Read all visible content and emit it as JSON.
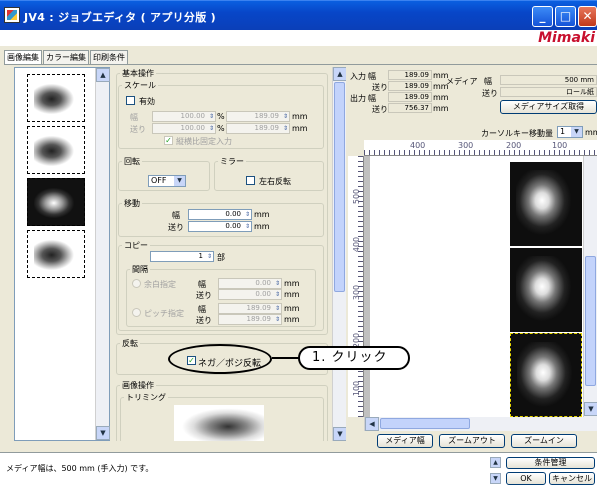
{
  "window": {
    "title": "JV4 : ジョブエディタ ( アプリ分版 )",
    "brand": "Mimaki",
    "min": "_",
    "max": "□",
    "close": "✕"
  },
  "tabs": [
    "画像編集",
    "カラー編集",
    "印刷条件"
  ],
  "settings": {
    "basic_group": "基本操作",
    "scale": {
      "group": "スケール",
      "enabled_label": "有効",
      "width_label": "幅",
      "feed_label": "送り",
      "width_pct": "100.00",
      "feed_pct": "100.00",
      "pct_unit": "%",
      "width_mm": "189.09",
      "feed_mm": "189.09",
      "mm_unit": "mm",
      "keep_ratio_label": "縦横比固定入力"
    },
    "rotate": {
      "group": "回転",
      "value": "OFF"
    },
    "mirror": {
      "group": "ミラー",
      "lr_label": "左右反転"
    },
    "move": {
      "group": "移動",
      "width_label": "幅",
      "feed_label": "送り",
      "width": "0.00",
      "feed": "0.00",
      "unit": "mm"
    },
    "copy": {
      "group": "コピー",
      "count": "1",
      "count_unit": "部",
      "interval_group": "間隔",
      "margin_label": "余白指定",
      "pitch_label": "ピッチ指定",
      "width_label": "幅",
      "feed_label": "送り",
      "margin_width": "0.00",
      "margin_feed": "0.00",
      "pitch_width": "189.09",
      "pitch_feed": "189.09",
      "unit": "mm"
    },
    "invert": {
      "group": "反転",
      "negpos_label": "ネガ／ポジ反転",
      "checked": true
    },
    "image_ops_group": "画像操作",
    "trimming_group": "トリミング"
  },
  "preview": {
    "input_label": "入力",
    "output_label": "出力",
    "width_label": "幅",
    "feed_label": "送り",
    "input_width": "189.09",
    "input_feed": "189.09",
    "output_width": "189.09",
    "output_feed": "756.37",
    "unit": "mm",
    "media_label": "メディア",
    "media_width_label": "幅",
    "media_feed_label": "送り",
    "media_width": "500 mm",
    "media_feed": "ロール紙",
    "get_media_size": "メディアサイズ取得",
    "cursor_key_label": "カーソルキー移動量",
    "cursor_key_value": "1",
    "cursor_key_unit": "mm",
    "ruler_h": [
      "400",
      "300",
      "200",
      "100"
    ],
    "ruler_v": [
      "500",
      "400",
      "300",
      "200",
      "100"
    ],
    "btn_media_width": "メディア幅",
    "btn_zoom_out": "ズームアウト",
    "btn_zoom_in": "ズームイン"
  },
  "status": {
    "message": "メディア幅は、500 mm (手入力) です。",
    "condition_mgmt": "条件管理",
    "ok": "OK",
    "cancel": "キャンセル"
  },
  "callout": {
    "text": "1. クリック"
  }
}
